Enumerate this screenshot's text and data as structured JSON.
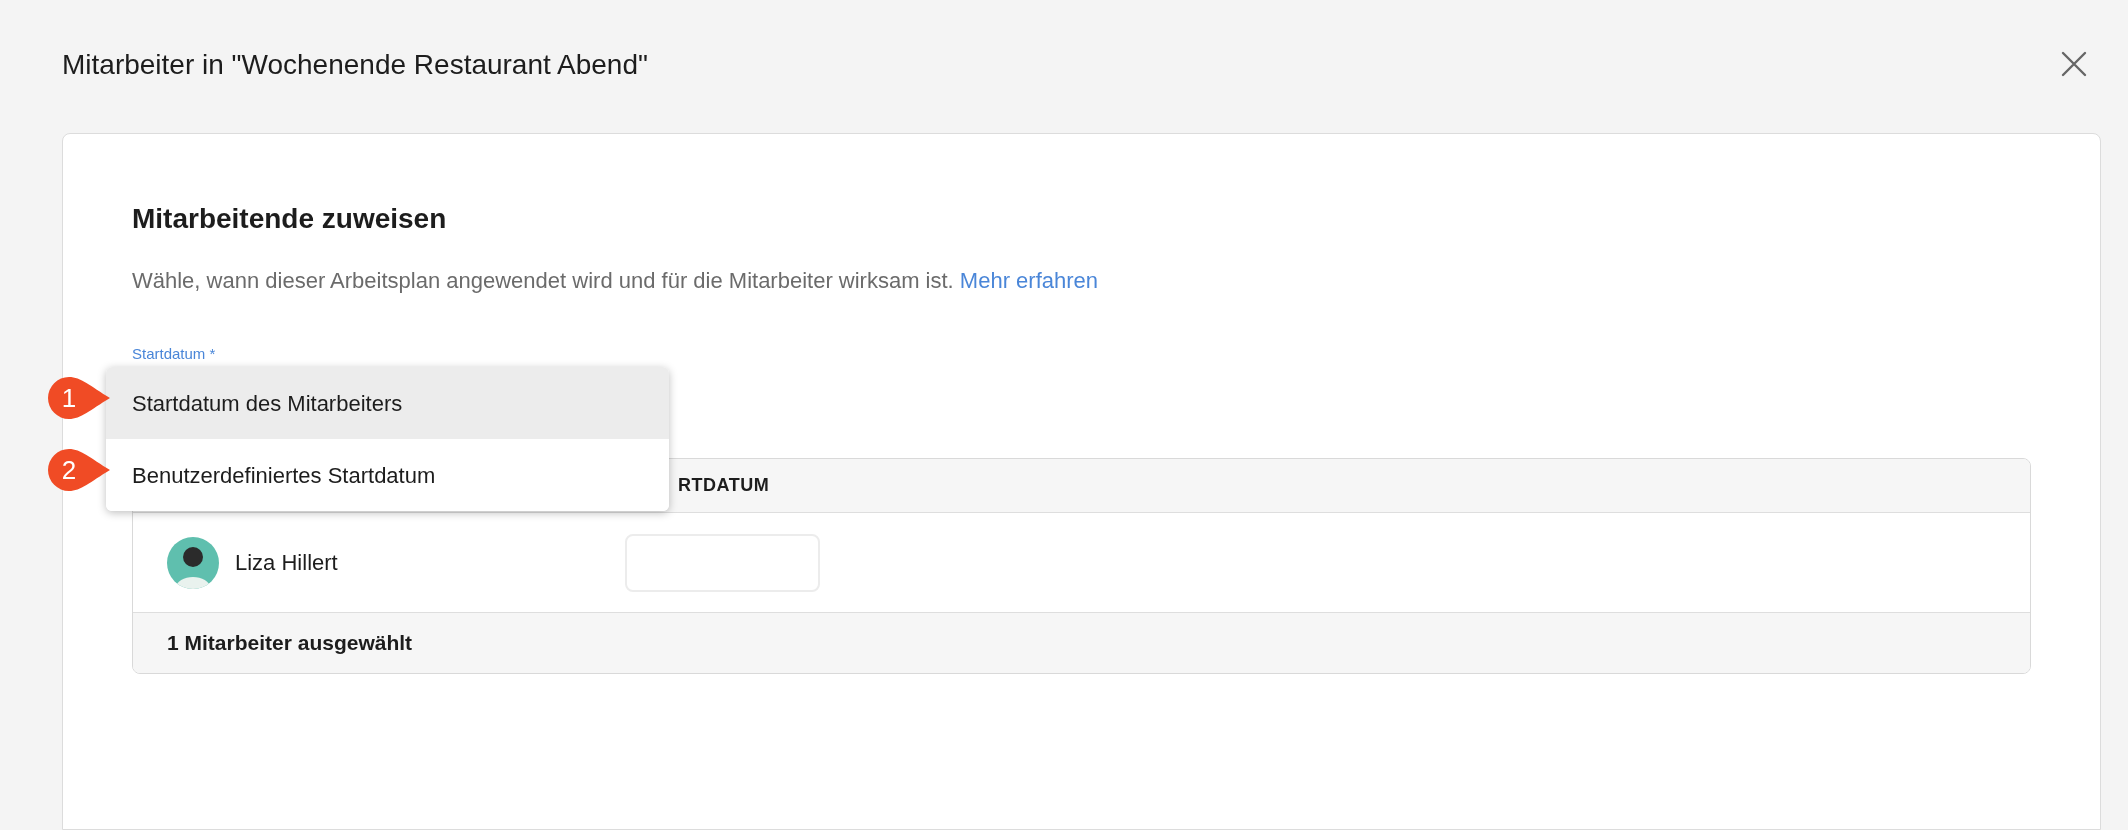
{
  "dialog": {
    "title": "Mitarbeiter in \"Wochenende Restaurant Abend\""
  },
  "section": {
    "heading": "Mitarbeitende zuweisen",
    "description": "Wähle, wann dieser Arbeitsplan angewendet wird und für die Mitarbeiter wirksam ist.",
    "link": "Mehr erfahren"
  },
  "field": {
    "label": "Startdatum *"
  },
  "dropdown": {
    "options": [
      {
        "label": "Startdatum des Mitarbeiters",
        "selected": true,
        "marker": "1"
      },
      {
        "label": "Benutzerdefiniertes Startdatum",
        "selected": false,
        "marker": "2"
      }
    ]
  },
  "table": {
    "column_header": "RTDATUM",
    "rows": [
      {
        "name": "Liza Hillert"
      }
    ],
    "footer": "1 Mitarbeiter ausgewählt"
  }
}
